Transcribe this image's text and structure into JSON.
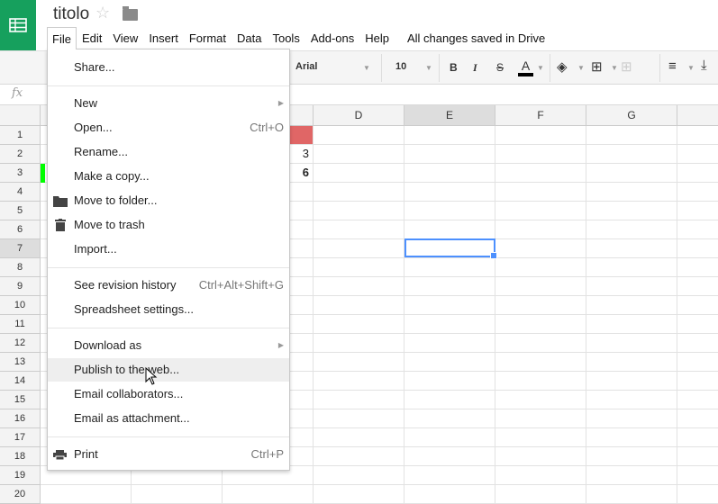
{
  "app": {
    "title": "titolo",
    "status": "All changes saved in Drive"
  },
  "menubar": [
    "File",
    "Edit",
    "View",
    "Insert",
    "Format",
    "Data",
    "Tools",
    "Add-ons",
    "Help"
  ],
  "toolbar": {
    "font": "Arial",
    "size": "10",
    "bold": "B",
    "italic": "I",
    "strike": "S",
    "text_color": "A"
  },
  "formula_bar": {
    "fx": "fx"
  },
  "columns": [
    "D",
    "E",
    "F",
    "G"
  ],
  "rows": [
    "1",
    "2",
    "3",
    "4",
    "5",
    "6",
    "7",
    "8",
    "9",
    "10",
    "11",
    "12",
    "13",
    "14",
    "15",
    "16",
    "17",
    "18",
    "19",
    "20"
  ],
  "cells": {
    "C2": "3",
    "C3": "6"
  },
  "colors": {
    "brand": "#16a05d",
    "c1_fill": "#e06666",
    "a3_fill": "#00ff00",
    "selection": "#4d90fe"
  },
  "file_menu": {
    "share": "Share...",
    "new": "New",
    "open": "Open...",
    "open_sc": "Ctrl+O",
    "rename": "Rename...",
    "copy": "Make a copy...",
    "move_folder": "Move to folder...",
    "trash": "Move to trash",
    "import": "Import...",
    "revision": "See revision history",
    "revision_sc": "Ctrl+Alt+Shift+G",
    "settings": "Spreadsheet settings...",
    "download": "Download as",
    "publish": "Publish to the web...",
    "email_collab": "Email collaborators...",
    "email_attach": "Email as attachment...",
    "print": "Print",
    "print_sc": "Ctrl+P"
  }
}
